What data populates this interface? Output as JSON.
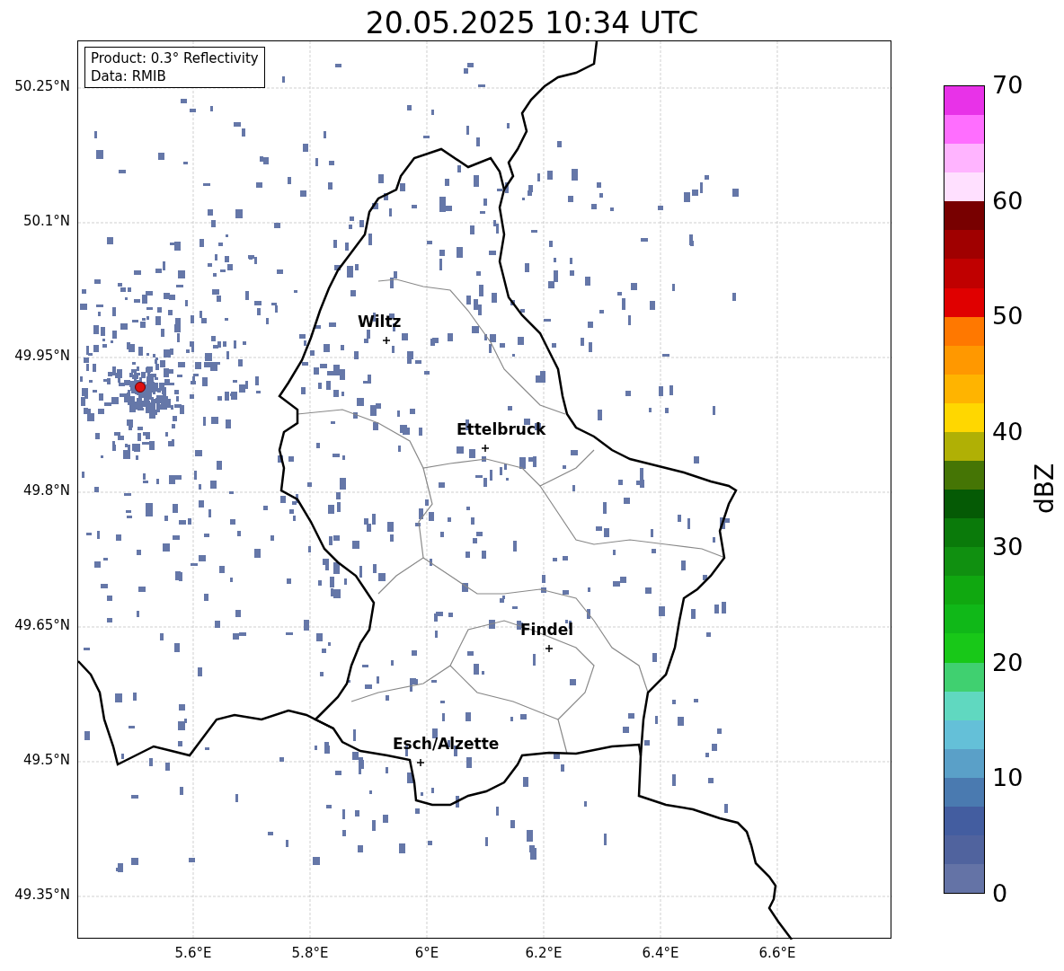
{
  "title": "20.05.2025 10:34 UTC",
  "map": {
    "legend": [
      "Product: 0.3° Reflectivity",
      "Data: RMIB"
    ],
    "yticks": [
      "50.25°N",
      "50.1°N",
      "49.95°N",
      "49.8°N",
      "49.65°N",
      "49.5°N",
      "49.35°N"
    ],
    "xticks": [
      "5.6°E",
      "5.8°E",
      "6°E",
      "6.2°E",
      "6.4°E",
      "6.6°E"
    ],
    "cities": [
      {
        "name": "Wiltz"
      },
      {
        "name": "Ettelbruck"
      },
      {
        "name": "Findel"
      },
      {
        "name": "Esch/Alzette"
      }
    ]
  },
  "colorbar": {
    "label": "dBZ",
    "ticks": [
      "70",
      "60",
      "50",
      "40",
      "30",
      "20",
      "10",
      "0"
    ],
    "segments": [
      {
        "color": "#e832e8"
      },
      {
        "color": "#ff6eff"
      },
      {
        "color": "#ffb4ff"
      },
      {
        "color": "#ffe0ff"
      },
      {
        "color": "#780000"
      },
      {
        "color": "#a00000"
      },
      {
        "color": "#c00000"
      },
      {
        "color": "#e00000"
      },
      {
        "color": "#ff7800"
      },
      {
        "color": "#ff9800"
      },
      {
        "color": "#ffb400"
      },
      {
        "color": "#ffd700"
      },
      {
        "color": "#b0b005"
      },
      {
        "color": "#457505"
      },
      {
        "color": "#055a05"
      },
      {
        "color": "#0a7a0a"
      },
      {
        "color": "#109010"
      },
      {
        "color": "#10a810"
      },
      {
        "color": "#10b818"
      },
      {
        "color": "#18c818"
      },
      {
        "color": "#40d070"
      },
      {
        "color": "#60d8c0"
      },
      {
        "color": "#64c0d8"
      },
      {
        "color": "#5aa0c8"
      },
      {
        "color": "#4a7ab0"
      },
      {
        "color": "#435da0"
      },
      {
        "color": "#50639e"
      },
      {
        "color": "#6473a6"
      }
    ]
  }
}
